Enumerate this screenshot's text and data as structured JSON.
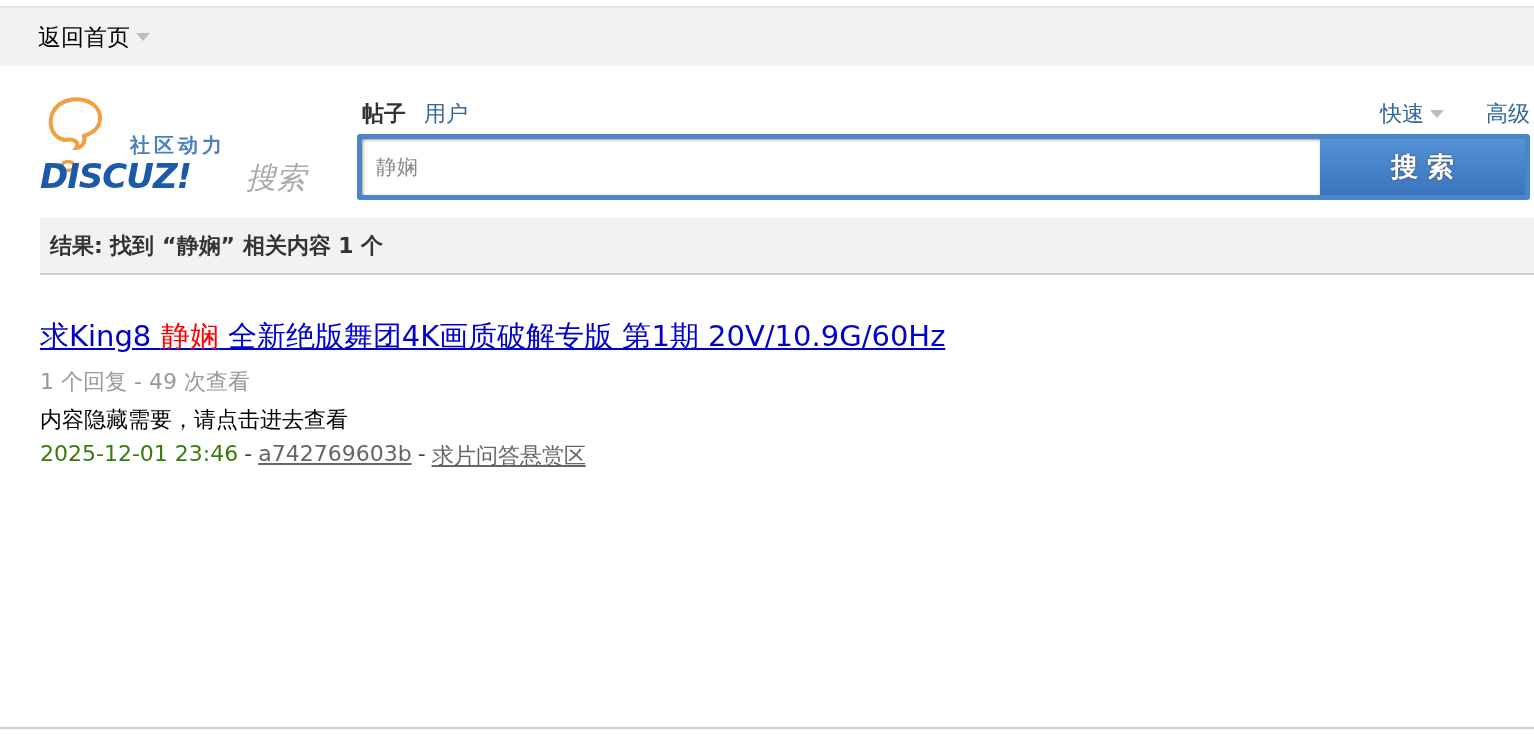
{
  "nav": {
    "home_link": "返回首页"
  },
  "logo": {
    "tagline": "社区动力",
    "brand": "DISCUZ!",
    "label": "搜索"
  },
  "search_tabs": [
    {
      "label": "帖子",
      "selected": true
    },
    {
      "label": "用户",
      "selected": false
    }
  ],
  "search_options": {
    "quick": "快速",
    "advanced": "高级"
  },
  "search": {
    "value": "静娴",
    "button": "搜 索"
  },
  "results_header": "结果: 找到 “静娴” 相关内容 1 个",
  "results": [
    {
      "title": [
        {
          "text": "求King8 ",
          "highlight": false
        },
        {
          "text": "静娴",
          "highlight": true
        },
        {
          "text": " 全新绝版舞团4K画质破解专版 第1期 20V/10.9G/60Hz",
          "highlight": false
        }
      ],
      "stats": "1 个回复 - 49 次查看",
      "summary": "内容隐藏需要，请点击进去查看",
      "date": "2025-12-01 23:46",
      "author": "a742769603b",
      "forum": "求片问答悬赏区",
      "separators": [
        "-",
        "-"
      ]
    }
  ]
}
